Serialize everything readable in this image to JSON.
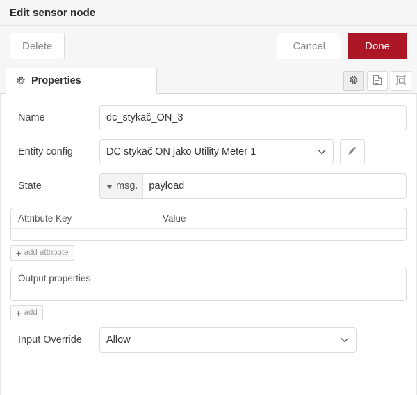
{
  "dialog": {
    "title": "Edit sensor node"
  },
  "buttons": {
    "delete": "Delete",
    "cancel": "Cancel",
    "done": "Done"
  },
  "tabs": [
    {
      "label": "Properties",
      "icon": "gear-icon",
      "active": true
    }
  ],
  "tab_tools": [
    {
      "name": "gear-icon",
      "active": true
    },
    {
      "name": "description-icon",
      "active": false
    },
    {
      "name": "appearance-icon",
      "active": false
    }
  ],
  "form": {
    "name": {
      "label": "Name",
      "value": "dc_stykač_ON_3",
      "placeholder": "Name"
    },
    "entity_config": {
      "label": "Entity config",
      "value": "DC stykač ON jako Utility Meter 1",
      "edit_icon": "pencil-icon",
      "chevron": "chevron-down-icon"
    },
    "state": {
      "label": "State",
      "type_prefix": "msg.",
      "value": "payload",
      "caret": "caret-down-icon"
    },
    "attributes": {
      "columns": [
        "Attribute Key",
        "Value"
      ],
      "rows": [],
      "add_label": "add attribute",
      "add_plus": "+"
    },
    "output_properties": {
      "columns": [
        "Output properties"
      ],
      "rows": [],
      "add_label": "add",
      "add_plus": "+"
    },
    "input_override": {
      "label": "Input Override",
      "value": "Allow",
      "chevron": "chevron-down-icon"
    }
  },
  "colors": {
    "accent_done": "#ad1625",
    "header_bg": "#f6f6f6",
    "border": "#dcdcdc"
  }
}
